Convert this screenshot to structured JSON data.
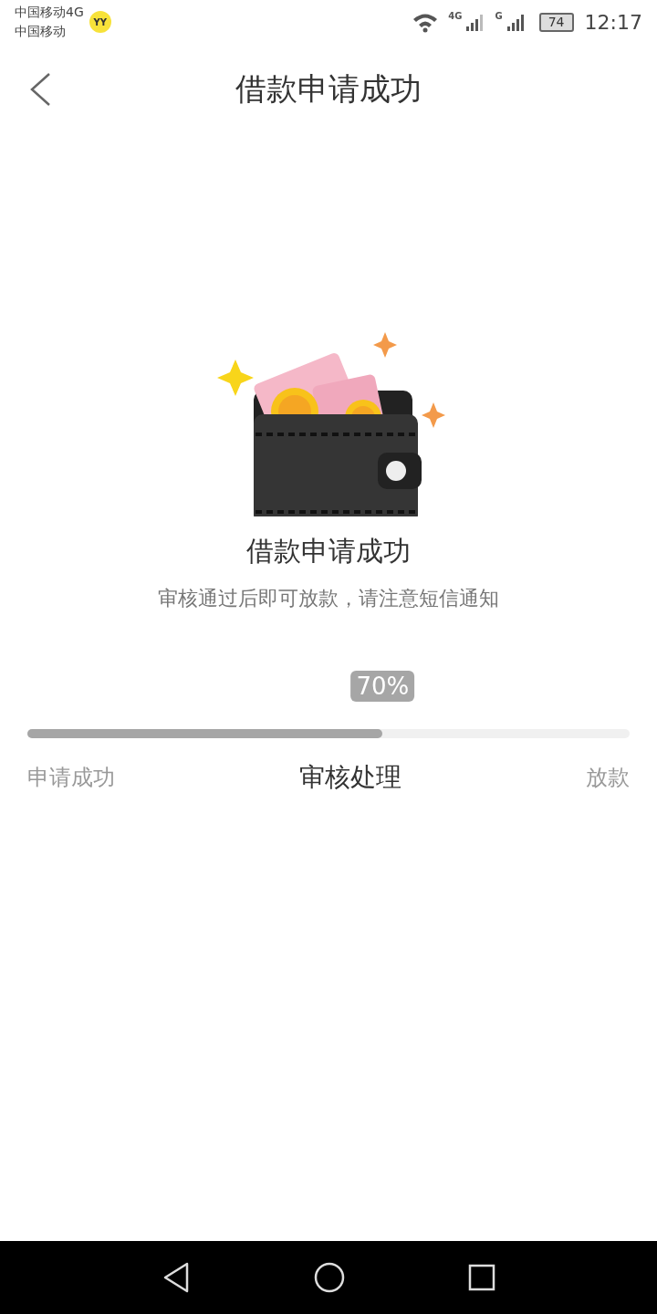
{
  "status_bar": {
    "carriers": [
      "中国移动4G",
      "中国移动"
    ],
    "app_badge": "YY",
    "signal_labels": [
      "4G",
      "G"
    ],
    "battery": "74",
    "time": "12:17"
  },
  "nav": {
    "title": "借款申请成功"
  },
  "result": {
    "title": "借款申请成功",
    "message": "审核通过后即可放款，请注意短信通知"
  },
  "progress": {
    "level": 0.59,
    "reading": "70%",
    "steps": [
      {
        "label": "申请成功",
        "active": false
      },
      {
        "label": "审核处理",
        "active": true
      },
      {
        "label": "放款",
        "active": false
      }
    ]
  }
}
